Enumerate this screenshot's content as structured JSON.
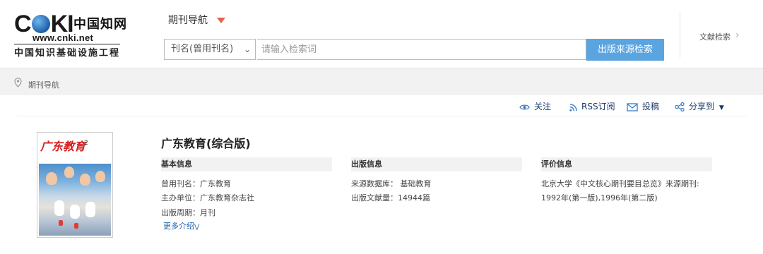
{
  "header": {
    "logo_text": "CNKI",
    "logo_cn": "中国知网",
    "logo_url": "www.cnki.net",
    "logo_tagline": "中国知识基础设施工程",
    "nav_label": "期刊导航",
    "select_value": "刊名(曾用刊名)",
    "search_placeholder": "请输入检索词",
    "search_button": "出版来源检索",
    "lit_search": "文献检索"
  },
  "breadcrumb": {
    "label": "期刊导航"
  },
  "toolbar": {
    "follow": "关注",
    "rss": "RSS订阅",
    "submit": "投稿",
    "share": "分享到"
  },
  "journal": {
    "title": "广东教育(综合版)",
    "cover_title": "广东教育",
    "cover_number": "2",
    "basic": {
      "heading": "基本信息",
      "former_name": "曾用刊名：广东教育",
      "sponsor": "主办单位：广东教育杂志社",
      "period": "出版周期：月刊",
      "more": "更多介绍"
    },
    "publish": {
      "heading": "出版信息",
      "database": "来源数据库：  基础教育",
      "count": "出版文献量：14944篇"
    },
    "evaluation": {
      "heading": "评价信息",
      "line1": "北京大学《中文核心期刊要目总览》来源期刊:",
      "line2": "1992年(第一版),1996年(第二版)"
    }
  },
  "colors": {
    "search_button": "#5aa4e0",
    "nav_caret": "#e8604c",
    "link": "#1a5fa8"
  }
}
